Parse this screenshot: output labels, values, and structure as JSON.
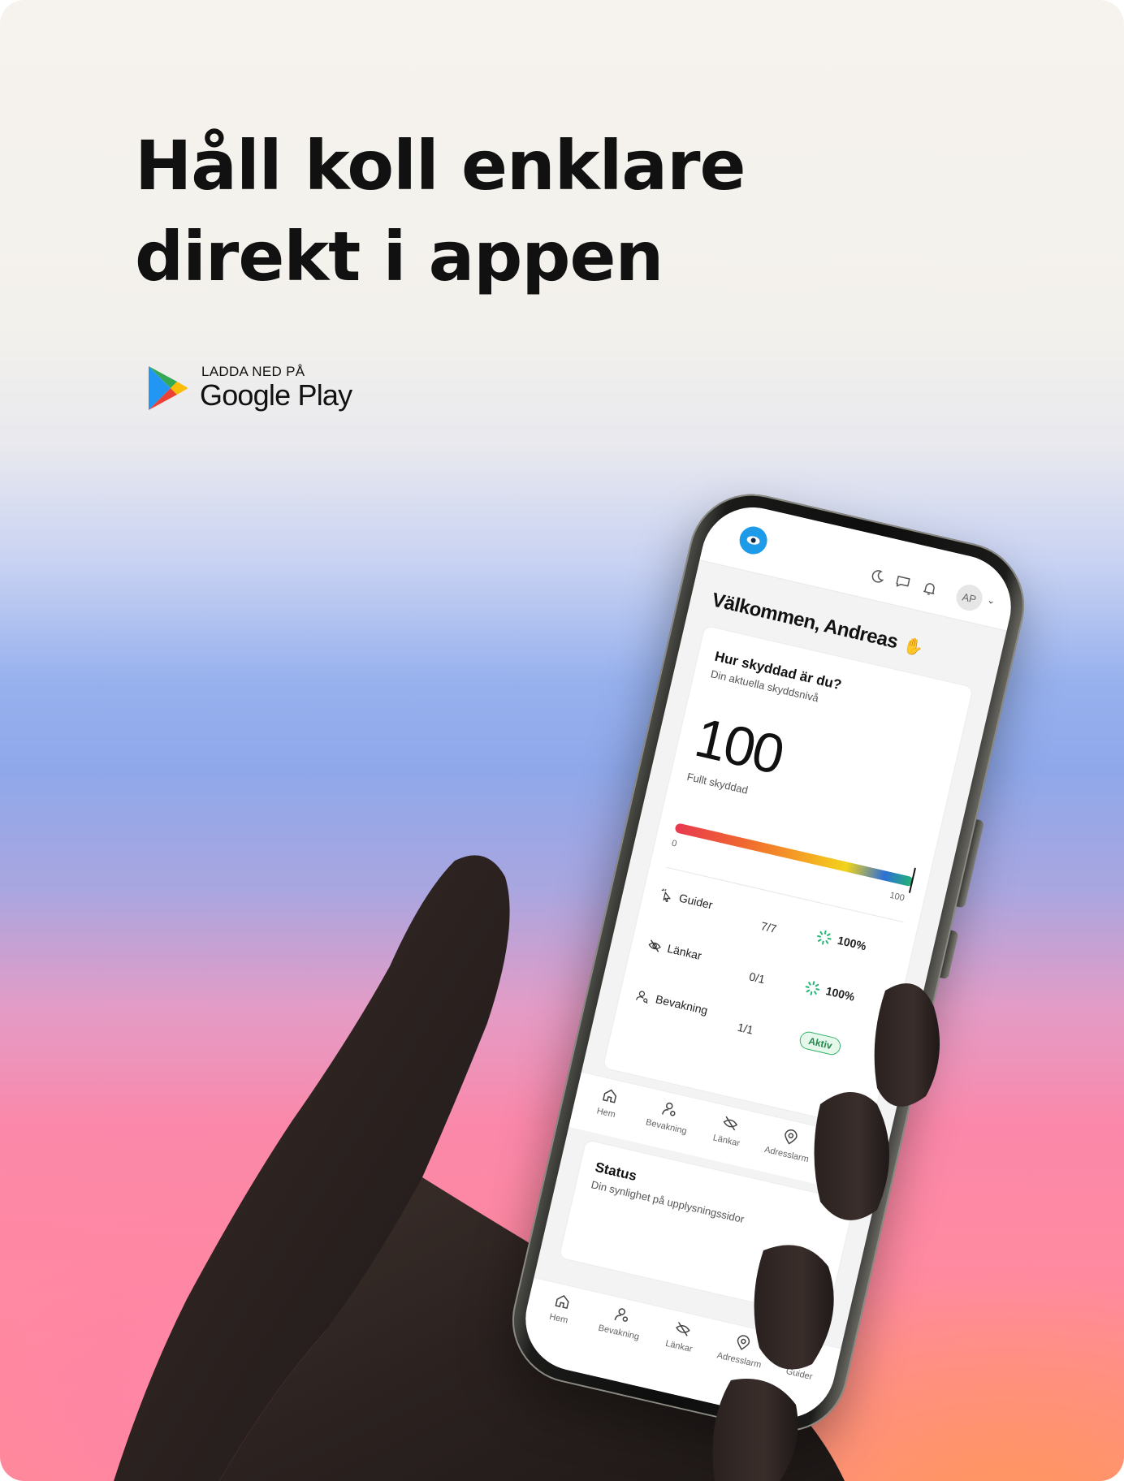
{
  "headline": {
    "line1": "Håll koll enklare",
    "line2": "direkt i appen"
  },
  "store_badge": {
    "small": "LADDA NED PÅ",
    "big": "Google Play"
  },
  "app": {
    "header": {
      "avatar_initials": "AP",
      "icons": [
        "moon-icon",
        "chat-icon",
        "bell-icon"
      ]
    },
    "welcome": "Välkommen, Andreas",
    "protection": {
      "title": "Hur skyddad är du?",
      "subtitle": "Din aktuella skyddsnivå",
      "score": "100",
      "score_label": "Fullt skyddad",
      "meter_min": "0",
      "meter_max": "100",
      "meter_level": 1.0,
      "rows": [
        {
          "label": "Guider",
          "value": "7/7",
          "percent": "100%"
        },
        {
          "label": "Länkar",
          "value": "0/1",
          "percent": "100%"
        },
        {
          "label": "Bevakning",
          "value": "1/1",
          "badge": "Aktiv"
        }
      ]
    },
    "tabs": [
      "Hem",
      "Bevakning",
      "Länkar",
      "Adresslarm",
      "Guider"
    ],
    "status": {
      "title": "Status",
      "subtitle": "Din synlighet på upplysningssidor"
    }
  },
  "colors": {
    "brand_blue": "#1e9be8",
    "success_green": "#22b573",
    "text_dark": "#111111"
  }
}
